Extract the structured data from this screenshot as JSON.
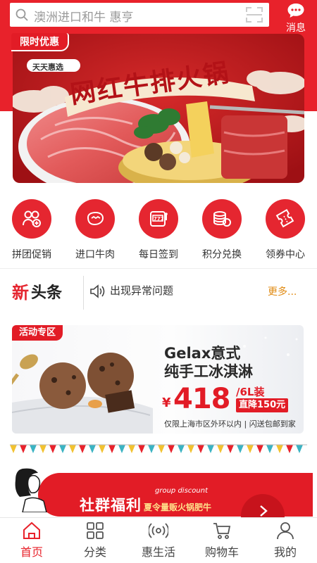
{
  "search": {
    "placeholder": "澳洲进口和牛 惠亨"
  },
  "header": {
    "message_label": "消息"
  },
  "banner": {
    "badge": "限时优惠",
    "small_tag": "天天惠选",
    "title": "网红牛排火锅"
  },
  "quick_menu": [
    {
      "label": "拼团促销",
      "icon": "group-buy-icon"
    },
    {
      "label": "进口牛肉",
      "icon": "steak-icon"
    },
    {
      "label": "每日签到",
      "icon": "slot-machine-icon"
    },
    {
      "label": "积分兑换",
      "icon": "coins-icon"
    },
    {
      "label": "领券中心",
      "icon": "coupon-icon"
    }
  ],
  "news": {
    "logo_first": "新",
    "logo_rest": "头条",
    "headline": "出现异常问题",
    "more": "更多..."
  },
  "promo": {
    "tag": "活动专区",
    "title_line1": "Gelax意式",
    "title_line2": "纯手工冰淇淋",
    "currency": "¥",
    "price": "418",
    "unit": "/6L装",
    "discount": "直降150元",
    "shipping": "仅限上海市区外环以内 | 闪送包邮到家"
  },
  "welfare": {
    "title": "社群福利",
    "subtitle_en": "group discount",
    "subtitle": "夏令量贩火锅肥牛"
  },
  "tabbar": [
    {
      "label": "首页",
      "icon": "home-icon",
      "active": true
    },
    {
      "label": "分类",
      "icon": "grid-icon",
      "active": false
    },
    {
      "label": "惠生活",
      "icon": "broadcast-icon",
      "active": false
    },
    {
      "label": "购物车",
      "icon": "cart-icon",
      "active": false
    },
    {
      "label": "我的",
      "icon": "user-icon",
      "active": false
    }
  ],
  "colors": {
    "brand_red": "#e8222b",
    "accent_orange": "#e08a12"
  }
}
